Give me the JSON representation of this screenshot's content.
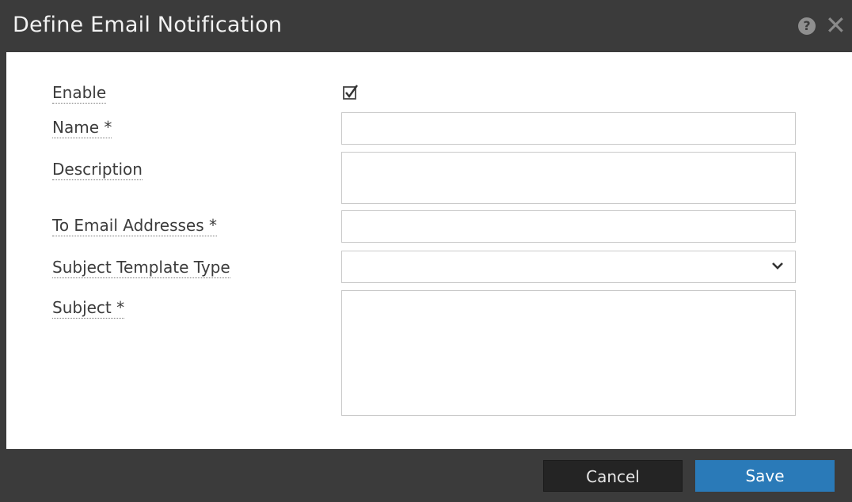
{
  "dialog": {
    "title": "Define Email Notification",
    "help_icon": "question-circle-icon",
    "close_icon": "close-icon",
    "close_glyph": "✕"
  },
  "form": {
    "enable_label": "Enable",
    "enable_checked": true,
    "name_label": "Name *",
    "name_value": "",
    "description_label": "Description",
    "description_value": "",
    "to_email_label": "To Email Addresses *",
    "to_email_value": "",
    "subject_template_type_label": "Subject Template Type",
    "subject_template_type_value": "",
    "subject_label": "Subject *",
    "subject_value": ""
  },
  "footer": {
    "cancel_label": "Cancel",
    "save_label": "Save"
  },
  "colors": {
    "titlebar_bg": "#3b3b3b",
    "save_button": "#2a7ab8",
    "cancel_button": "#242424"
  }
}
